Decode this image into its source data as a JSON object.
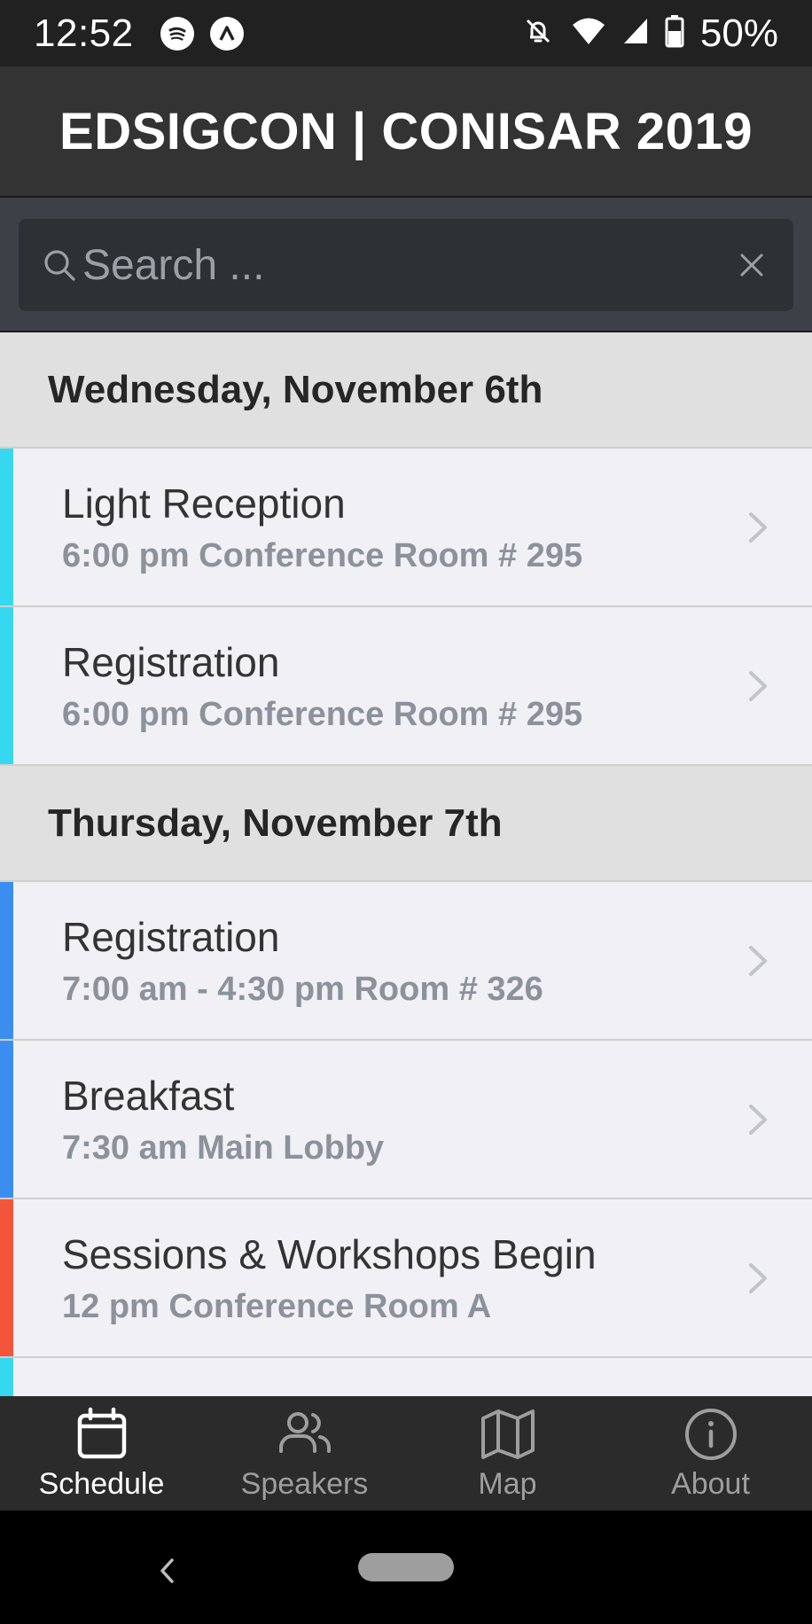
{
  "status_bar": {
    "time": "12:52",
    "left_icons": [
      "spotify-icon",
      "app-notification-icon"
    ],
    "right_icons": [
      "notifications-off-icon",
      "wifi-icon",
      "cell-signal-icon",
      "battery-icon"
    ],
    "battery": "50%"
  },
  "header": {
    "title": "EDSIGCON | CONISAR 2019"
  },
  "search": {
    "placeholder": "Search ...",
    "value": ""
  },
  "colors": {
    "track_cyan": "#36d8f0",
    "track_blue": "#3b8ef0",
    "track_orange": "#f3553a",
    "header_bg": "#333333",
    "tab_active": "#ffffff",
    "tab_inactive": "#9e9e9e"
  },
  "schedule": {
    "groups": [
      {
        "date": "Wednesday, November 6th",
        "items": [
          {
            "title": "Light Reception",
            "subtitle": "6:00 pm Conference Room # 295",
            "track_color": "#36d8f0"
          },
          {
            "title": "Registration",
            "subtitle": "6:00 pm Conference Room # 295",
            "track_color": "#36d8f0"
          }
        ]
      },
      {
        "date": "Thursday, November 7th",
        "items": [
          {
            "title": "Registration",
            "subtitle": "7:00 am - 4:30 pm Room # 326",
            "track_color": "#3b8ef0"
          },
          {
            "title": "Breakfast",
            "subtitle": "7:30 am Main Lobby",
            "track_color": "#3b8ef0"
          },
          {
            "title": "Sessions & Workshops Begin",
            "subtitle": "12 pm Conference Room A",
            "track_color": "#f3553a"
          }
        ]
      }
    ]
  },
  "tabs": [
    {
      "label": "Schedule",
      "icon": "calendar-icon",
      "active": true
    },
    {
      "label": "Speakers",
      "icon": "people-icon",
      "active": false
    },
    {
      "label": "Map",
      "icon": "map-icon",
      "active": false
    },
    {
      "label": "About",
      "icon": "info-icon",
      "active": false
    }
  ]
}
